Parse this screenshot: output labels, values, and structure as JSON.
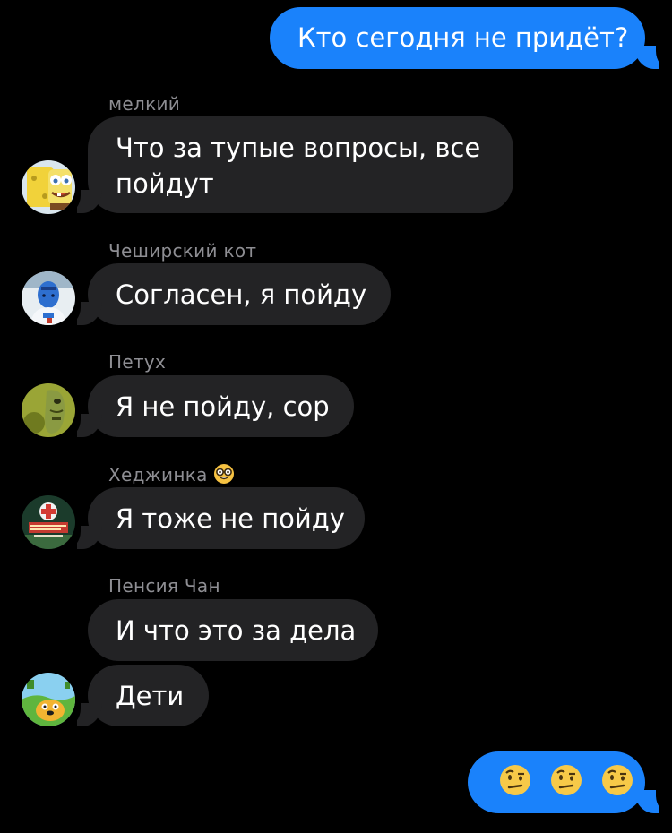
{
  "chat": {
    "outgoing_1": {
      "text": "Кто сегодня не придёт?"
    },
    "messages": [
      {
        "sender": "мелкий",
        "lines": [
          "Что за тупые вопросы, все",
          "пойдут"
        ],
        "avatar_icon": "spongebob-avatar-icon"
      },
      {
        "sender": "Чеширский кот",
        "text": "Согласен, я пойду",
        "avatar_icon": "blue-athlete-avatar-icon"
      },
      {
        "sender": "Петух",
        "text": "Я не пойду, сор",
        "avatar_icon": "green-creature-avatar-icon"
      },
      {
        "sender": "Хеджинка",
        "sender_emoji": "nerd-face-emoji-icon",
        "text": "Я тоже не пойду",
        "avatar_icon": "poster-avatar-icon"
      },
      {
        "sender": "Пенсия Чан",
        "texts": [
          "И что это за дела",
          "Дети"
        ],
        "avatar_icon": "jake-dog-avatar-icon"
      }
    ],
    "outgoing_2": {
      "emojis": [
        "face-with-raised-eyebrow-icon",
        "face-with-raised-eyebrow-icon",
        "face-with-raised-eyebrow-icon"
      ]
    }
  },
  "colors": {
    "background": "#000000",
    "outgoing_bubble": "#1a82fb",
    "incoming_bubble": "#232325",
    "sender_name": "#8e8e93",
    "text": "#ffffff"
  }
}
